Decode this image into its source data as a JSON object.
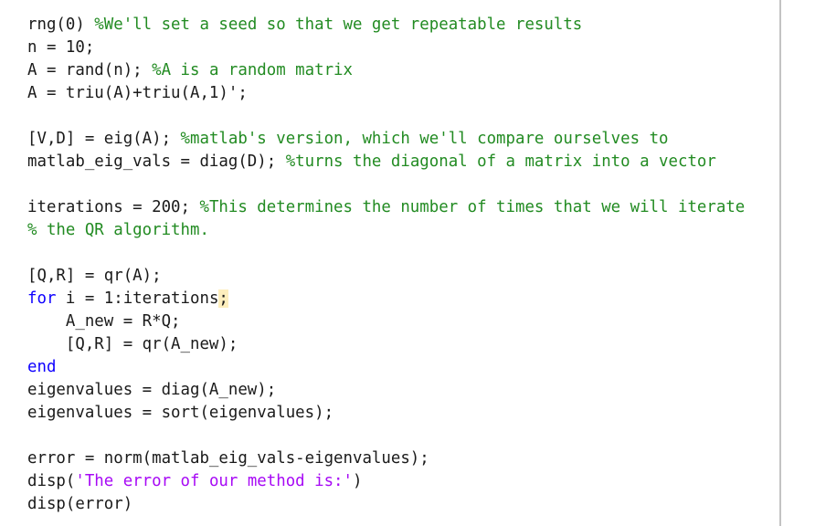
{
  "editor": {
    "lines": [
      {
        "parts": [
          {
            "t": "rng(0) ",
            "c": ""
          },
          {
            "t": "%We'll set a seed so that we get repeatable results",
            "c": "cm"
          }
        ]
      },
      {
        "parts": [
          {
            "t": "n = 10;",
            "c": ""
          }
        ]
      },
      {
        "parts": [
          {
            "t": "A = rand(n); ",
            "c": ""
          },
          {
            "t": "%A is a random matrix",
            "c": "cm"
          }
        ]
      },
      {
        "parts": [
          {
            "t": "A = triu(A)+triu(A,1)';",
            "c": ""
          }
        ]
      },
      {
        "parts": []
      },
      {
        "parts": [
          {
            "t": "[V,D] = eig(A); ",
            "c": ""
          },
          {
            "t": "%matlab's version, which we'll compare ourselves to",
            "c": "cm"
          }
        ]
      },
      {
        "parts": [
          {
            "t": "matlab_eig_vals = diag(D); ",
            "c": ""
          },
          {
            "t": "%turns the diagonal of a matrix into a vector",
            "c": "cm"
          }
        ]
      },
      {
        "parts": []
      },
      {
        "parts": [
          {
            "t": "iterations = 200; ",
            "c": ""
          },
          {
            "t": "%This determines the number of times that we will iterate",
            "c": "cm"
          }
        ]
      },
      {
        "parts": [
          {
            "t": "% the QR algorithm.",
            "c": "cm"
          }
        ]
      },
      {
        "parts": []
      },
      {
        "parts": [
          {
            "t": "[Q,R] = qr(A);",
            "c": ""
          }
        ]
      },
      {
        "parts": [
          {
            "t": "for",
            "c": "kw"
          },
          {
            "t": " i = 1:iterations",
            "c": ""
          },
          {
            "t": ";",
            "c": "hl"
          }
        ]
      },
      {
        "parts": [
          {
            "t": "    A_new = R*Q;",
            "c": ""
          }
        ]
      },
      {
        "parts": [
          {
            "t": "    [Q,R] = qr(A_new);",
            "c": ""
          }
        ]
      },
      {
        "parts": [
          {
            "t": "end",
            "c": "kw"
          }
        ]
      },
      {
        "parts": [
          {
            "t": "eigenvalues = diag(A_new);",
            "c": ""
          }
        ]
      },
      {
        "parts": [
          {
            "t": "eigenvalues = sort(eigenvalues);",
            "c": ""
          }
        ]
      },
      {
        "parts": []
      },
      {
        "parts": [
          {
            "t": "error = norm(matlab_eig_vals-eigenvalues);",
            "c": ""
          }
        ]
      },
      {
        "parts": [
          {
            "t": "disp(",
            "c": ""
          },
          {
            "t": "'The error of our method is:'",
            "c": "str"
          },
          {
            "t": ")",
            "c": ""
          }
        ]
      },
      {
        "parts": [
          {
            "t": "disp(error)",
            "c": ""
          }
        ]
      }
    ],
    "warning_marker": {
      "line": 13,
      "text": ";"
    }
  },
  "colors": {
    "comment": "#228b22",
    "keyword": "#0e00ff",
    "string": "#a709f5",
    "warning_highlight": "#fdeebd"
  }
}
